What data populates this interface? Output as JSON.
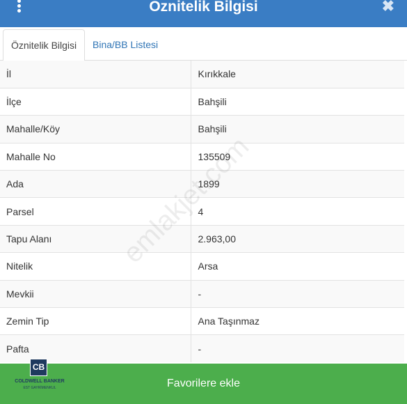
{
  "header": {
    "title": "Öznitelik Bilgisi",
    "close_glyph": "✖",
    "menu_icon": "vertical-ellipsis-icon",
    "background": "#3a7dc4"
  },
  "tabs": [
    {
      "label": "Öznitelik Bilgisi",
      "active": true
    },
    {
      "label": "Bina/BB Listesi",
      "active": false
    }
  ],
  "attributes": [
    {
      "key": "İl",
      "value": "Kırıkkale"
    },
    {
      "key": "İlçe",
      "value": "Bahşili"
    },
    {
      "key": "Mahalle/Köy",
      "value": "Bahşili"
    },
    {
      "key": "Mahalle No",
      "value": "135509"
    },
    {
      "key": "Ada",
      "value": "1899"
    },
    {
      "key": "Parsel",
      "value": "4"
    },
    {
      "key": "Tapu Alanı",
      "value": "2.963,00"
    },
    {
      "key": "Nitelik",
      "value": "Arsa"
    },
    {
      "key": "Mevkii",
      "value": "-"
    },
    {
      "key": "Zemin Tip",
      "value": "Ana Taşınmaz"
    },
    {
      "key": "Pafta",
      "value": "-"
    }
  ],
  "watermark": "emlakjet.com",
  "footer": {
    "button_label": "Favorilere ekle",
    "background": "#4cae4c"
  },
  "logo": {
    "mark": "CB",
    "name": "COLDWELL BANKER",
    "sub": "EST GAYRİMENKUL"
  }
}
